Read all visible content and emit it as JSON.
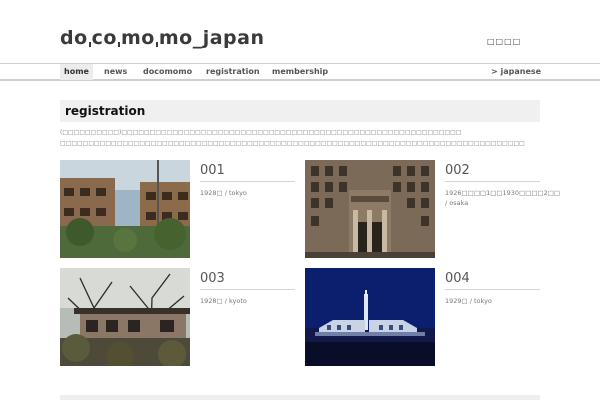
{
  "site": {
    "logo_text": "do_co_mo_mo_japan",
    "logo_parts": [
      "do",
      "co",
      "mo",
      "mo_japan"
    ],
    "lang_top": "□□□□"
  },
  "nav": {
    "items": [
      {
        "label": "home",
        "active": true
      },
      {
        "label": "news",
        "active": false
      },
      {
        "label": "docomomo",
        "active": false
      },
      {
        "label": "registration",
        "active": false
      },
      {
        "label": "membership",
        "active": false
      }
    ],
    "lang_link": "> japanese"
  },
  "main": {
    "title": "registration",
    "intro_line1": "(□□□□□□□□□□)□□□□□□□□□□□□□□□□□□□□□□□□□□□□□□□□□□□□□□□□□□□□□□□□□□□□□□□□□□□□",
    "intro_line2": "□□□□□□□□□□□□□□□□□□□□□□□□□□□□□□□□□□□□□□□□□□□□□□□□□□□□□□□□□□□□□□□□□□□□□□□□□□□□□□□□□□"
  },
  "registrations": [
    {
      "num": "001",
      "meta": "1928□ / tokyo"
    },
    {
      "num": "002",
      "meta": "1926□□□□1□□1930□□□□2□□ / osaka"
    },
    {
      "num": "003",
      "meta": "1928□ / kyoto"
    },
    {
      "num": "004",
      "meta": "1929□ / tokyo"
    }
  ],
  "colors": {
    "nav_active_bg": "#ececec",
    "title_bg": "#f0f0f0",
    "text": "#333333"
  }
}
